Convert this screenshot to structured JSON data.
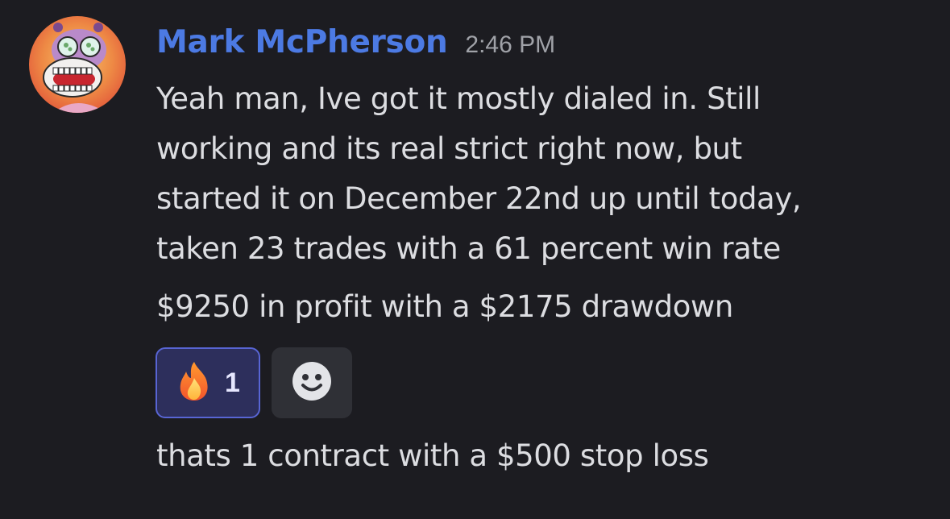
{
  "message": {
    "author": "Mark McPherson",
    "timestamp": "2:46 PM",
    "lines": [
      "Yeah man, Ive got it mostly dialed in. Still",
      "working and its real strict right now, but",
      "started it on December 22nd up until today,",
      "taken 23 trades with a 61 percent win rate",
      "$9250 in profit with a $2175 drawdown"
    ],
    "reactions": [
      {
        "emoji": "fire-emoji",
        "count": "1"
      }
    ],
    "add_reaction_icon": "smiley-icon",
    "followup": "thats 1 contract with a $500 stop loss"
  },
  "colors": {
    "background": "#1c1c21",
    "author": "#4c7ae3",
    "text": "#dcdde1",
    "reaction_bg": "#2d2f5c",
    "reaction_border": "#5865d4"
  }
}
